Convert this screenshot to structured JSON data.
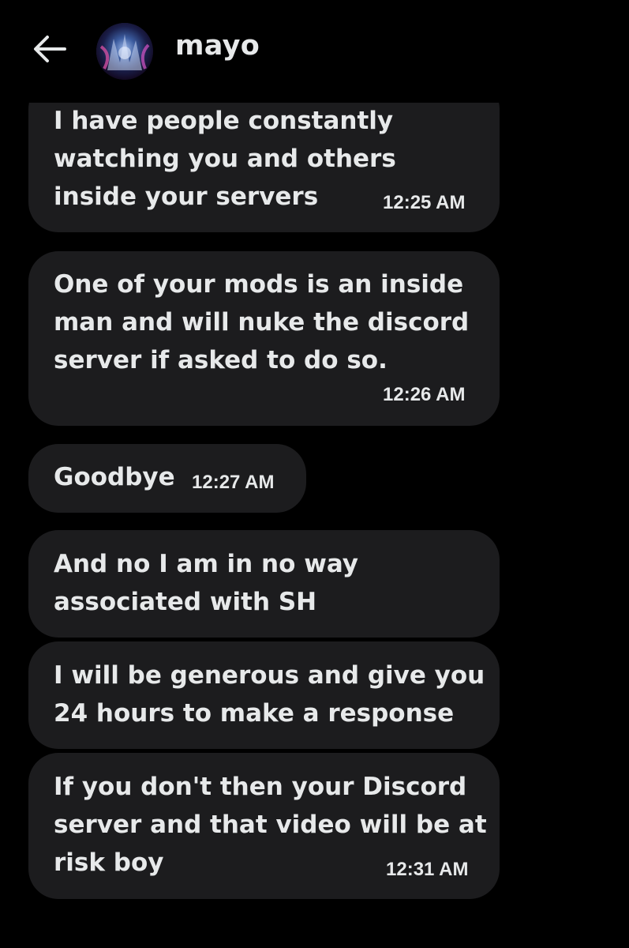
{
  "header": {
    "username": "mayo",
    "back_icon": "arrow-left-icon",
    "avatar": "user-avatar"
  },
  "messages": [
    {
      "lines": [
        "I have people constantly",
        "watching you and others",
        "inside your servers"
      ],
      "time": "12:25 AM"
    },
    {
      "lines": [
        "One of your mods is an inside",
        "man and will nuke the discord",
        "server if asked to do so."
      ],
      "time": "12:26 AM"
    },
    {
      "lines": [
        "Goodbye"
      ],
      "time": "12:27 AM"
    },
    {
      "lines": [
        "And no I am in no way",
        "associated with SH"
      ],
      "time": ""
    },
    {
      "lines": [
        "I will be generous and give you",
        "24 hours to make a response"
      ],
      "time": ""
    },
    {
      "lines": [
        "If you don't then your Discord",
        "server and that video will be at",
        "risk boy"
      ],
      "time": "12:31 AM"
    }
  ],
  "colors": {
    "background": "#000000",
    "bubble": "#1c1c1e",
    "text": "#e7e9ea"
  }
}
